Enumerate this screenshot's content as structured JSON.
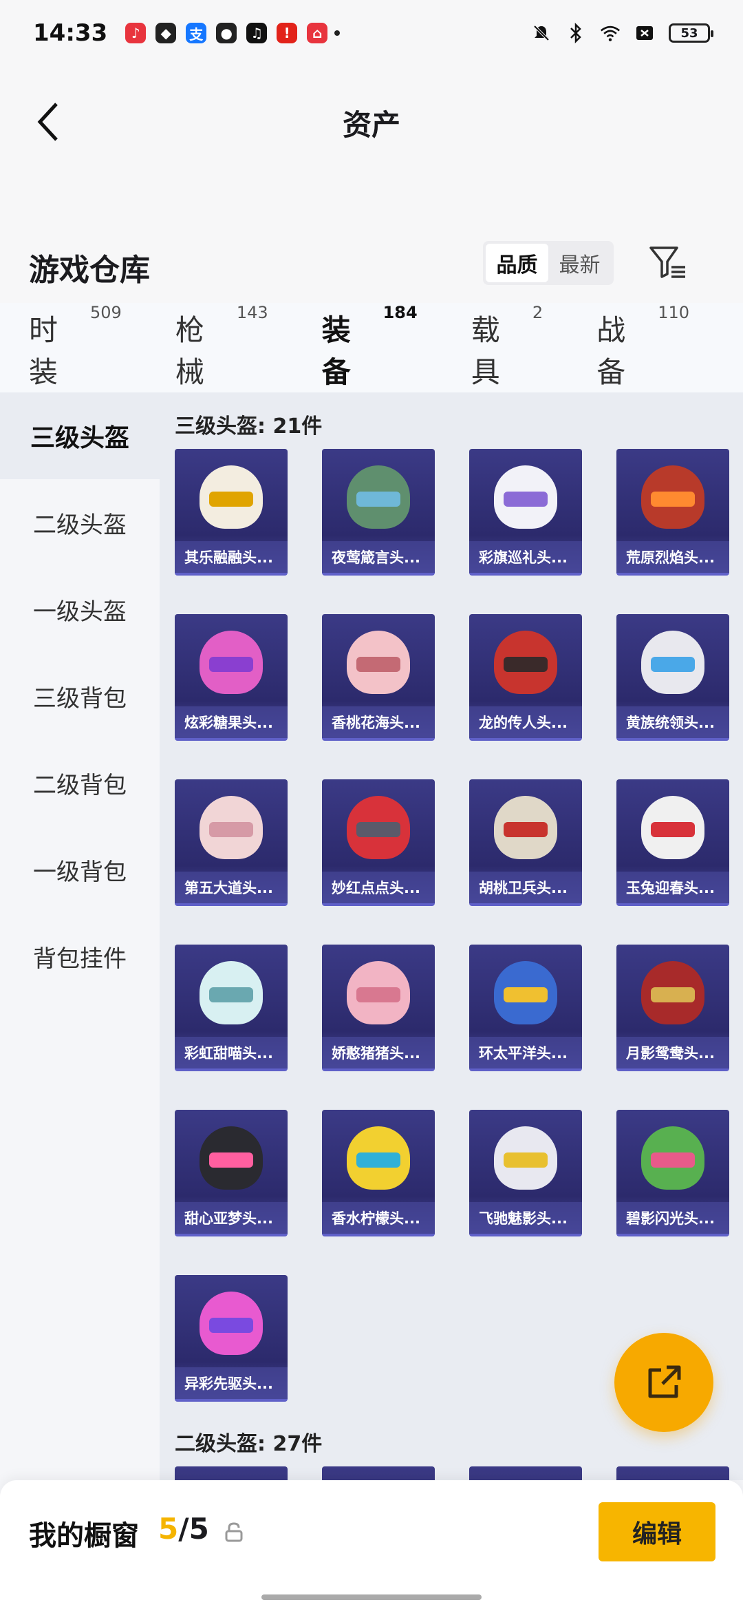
{
  "status_bar": {
    "time": "14:33",
    "battery": "53",
    "app_icons": [
      {
        "name": "music-icon",
        "color": "#e8343e",
        "glyph": "♪"
      },
      {
        "name": "shield-app-icon",
        "color": "#222222",
        "glyph": "◆"
      },
      {
        "name": "alipay-icon",
        "color": "#1677ff",
        "glyph": "支"
      },
      {
        "name": "wechat-icon",
        "color": "#222222",
        "glyph": "●"
      },
      {
        "name": "tiktok-icon",
        "color": "#111111",
        "glyph": "♫"
      },
      {
        "name": "red-app-icon",
        "color": "#e2231a",
        "glyph": "!"
      },
      {
        "name": "shopping-icon",
        "color": "#e8343e",
        "glyph": "⌂"
      }
    ]
  },
  "header": {
    "title": "资产"
  },
  "warehouse": {
    "title": "游戏仓库",
    "sort_options": [
      {
        "label": "品质",
        "active": true
      },
      {
        "label": "最新",
        "active": false
      }
    ]
  },
  "tabs": [
    {
      "label": "时装",
      "count": "509",
      "active": false
    },
    {
      "label": "枪械",
      "count": "143",
      "active": false
    },
    {
      "label": "装备",
      "count": "184",
      "active": true
    },
    {
      "label": "载具",
      "count": "2",
      "active": false
    },
    {
      "label": "战备",
      "count": "110",
      "active": false
    }
  ],
  "sidebar": [
    {
      "label": "三级头盔",
      "active": true
    },
    {
      "label": "二级头盔",
      "active": false
    },
    {
      "label": "一级头盔",
      "active": false
    },
    {
      "label": "三级背包",
      "active": false
    },
    {
      "label": "二级背包",
      "active": false
    },
    {
      "label": "一级背包",
      "active": false
    },
    {
      "label": "背包挂件",
      "active": false
    }
  ],
  "sections": [
    {
      "title": "三级头盔: 21件",
      "items": [
        {
          "name": "其乐融融头...",
          "helmet": "#f3ede0",
          "visor": "#e0a400"
        },
        {
          "name": "夜莺箴言头...",
          "helmet": "#5f8f6e",
          "visor": "#6fb8d8"
        },
        {
          "name": "彩旗巡礼头...",
          "helmet": "#f2f2f8",
          "visor": "#8b6bd6"
        },
        {
          "name": "荒原烈焰头...",
          "helmet": "#b83a2a",
          "visor": "#ff8a30"
        },
        {
          "name": "炫彩糖果头...",
          "helmet": "#e25fc6",
          "visor": "#8a3fd0"
        },
        {
          "name": "香桃花海头...",
          "helmet": "#f3c2c8",
          "visor": "#c46a74"
        },
        {
          "name": "龙的传人头...",
          "helmet": "#c8342e",
          "visor": "#3a2a2a"
        },
        {
          "name": "黄族统领头...",
          "helmet": "#e8e8ee",
          "visor": "#4aa8e8"
        },
        {
          "name": "第五大道头...",
          "helmet": "#f1d5d6",
          "visor": "#d69aa6"
        },
        {
          "name": "妙红点点头...",
          "helmet": "#d8323a",
          "visor": "#5a5a6a"
        },
        {
          "name": "胡桃卫兵头...",
          "helmet": "#e0d8c8",
          "visor": "#c8342e"
        },
        {
          "name": "玉兔迎春头...",
          "helmet": "#f0f0f0",
          "visor": "#d8323a"
        },
        {
          "name": "彩虹甜喵头...",
          "helmet": "#d8f0f2",
          "visor": "#6aa8b0"
        },
        {
          "name": "娇憨猪猪头...",
          "helmet": "#f2b4c4",
          "visor": "#d87890"
        },
        {
          "name": "环太平洋头...",
          "helmet": "#3a6ad0",
          "visor": "#f0c030"
        },
        {
          "name": "月影鸳鸯头...",
          "helmet": "#a82a2a",
          "visor": "#d8b050"
        },
        {
          "name": "甜心亚梦头...",
          "helmet": "#2a2a30",
          "visor": "#ff5fa0"
        },
        {
          "name": "香水柠檬头...",
          "helmet": "#f2d030",
          "visor": "#30b0d8"
        },
        {
          "name": "飞驰魅影头...",
          "helmet": "#e8e8f0",
          "visor": "#e8c030"
        },
        {
          "name": "碧影闪光头...",
          "helmet": "#58b050",
          "visor": "#e85a8a"
        },
        {
          "name": "异彩先驱头...",
          "helmet": "#e85ad0",
          "visor": "#7a4ae0"
        }
      ]
    },
    {
      "title": "二级头盔: 27件",
      "items": [
        {
          "name": "",
          "helmet": "#3a3a80",
          "visor": "#3a3a80"
        },
        {
          "name": "",
          "helmet": "#d8d8f0",
          "visor": "#3a3a80"
        },
        {
          "name": "",
          "helmet": "#3a3a80",
          "visor": "#3a3a80"
        },
        {
          "name": "",
          "helmet": "#e8a0d0",
          "visor": "#3a3a80"
        }
      ]
    }
  ],
  "showcase": {
    "label": "我的橱窗",
    "current": "5",
    "total": "/5",
    "edit_label": "编辑"
  },
  "colors": {
    "accent": "#f5b400",
    "card_bg": "#2c2a6c"
  }
}
